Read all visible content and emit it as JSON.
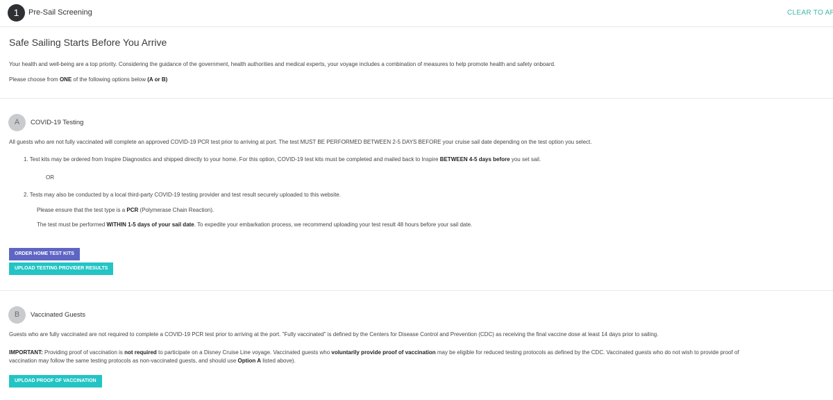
{
  "header": {
    "step_number": "1",
    "step_title": "Pre-Sail Screening",
    "status_link": "CLEAR TO ARRIVE"
  },
  "intro": {
    "title": "Safe Sailing Starts Before You Arrive",
    "paragraph": "Your health and well-being are a top priority. Considering the guidance of the government, health authorities and medical experts, your voyage includes a combination of measures to help promote health and safety onboard.",
    "choose_prefix": "Please choose from ",
    "choose_bold": "ONE",
    "choose_middle": " of the following options below ",
    "choose_options": "(A or B)"
  },
  "section_a": {
    "letter": "A",
    "title": "COVID-19 Testing",
    "description": "All guests who are not fully vaccinated will complete an approved COVID-19 PCR test prior to arriving at port. The test MUST BE PERFORMED BETWEEN 2-5 DAYS BEFORE your cruise sail date depending on the test option you select.",
    "item1_text": "1. Test kits may be ordered from Inspire Diagnostics and shipped directly to your home. For this option, COVID-19 test kits must be completed and mailed back to Inspire ",
    "item1_bold": "BETWEEN 4-5 days before",
    "item1_tail": " you set sail.",
    "or_text": "OR",
    "item2_text": "2. Tests may also be conducted by a local third-party COVID-19 testing provider and test result securely uploaded to this website.",
    "pcr_prefix": "Please ensure that the test type is a ",
    "pcr_bold": "PCR",
    "pcr_tail": " (Polymerase Chain Reaction).",
    "within_prefix": "The test must be performed ",
    "within_bold": "WITHIN 1-5 days of your sail date",
    "within_tail": ". To expedite your embarkation process, we recommend uploading your test result 48 hours before your sail date.",
    "order_button": "ORDER HOME TEST KITS",
    "upload_button": "UPLOAD TESTING PROVIDER RESULTS"
  },
  "section_b": {
    "letter": "B",
    "title": "Vaccinated Guests",
    "description": "Guests who are fully vaccinated are not required to complete a COVID-19 PCR test prior to arriving at the port. \"Fully vaccinated\" is defined by the Centers for Disease Control and Prevention (CDC) as receiving the final vaccine dose at least 14 days prior to sailing.",
    "important_label": "IMPORTANT:",
    "important_text1": " Providing proof of vaccination is ",
    "important_bold1": "not required",
    "important_text2": " to participate on a Disney Cruise Line voyage. Vaccinated guests who ",
    "important_bold2": "voluntarily provide proof of vaccination",
    "important_text3": " may be eligible for reduced testing protocols as defined by the CDC. Vaccinated guests who do not wish to provide proof of",
    "important_line2_text": "vaccination may follow the same testing protocols as non-vaccinated guests, and should use ",
    "important_line2_bold": "Option A",
    "important_line2_tail": " listed above).",
    "upload_button": "UPLOAD PROOF OF VACCINATION"
  },
  "colors": {
    "accent_teal": "#23c4c4",
    "accent_purple": "#5f65c3",
    "status_green": "#3bb8a8"
  }
}
